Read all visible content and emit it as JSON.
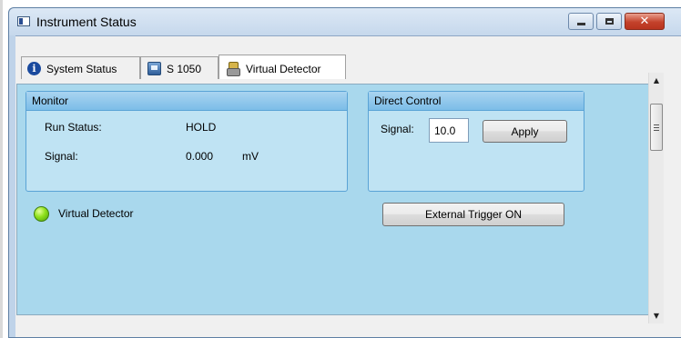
{
  "window": {
    "title": "Instrument Status",
    "buttons": {
      "minimize": "minimize",
      "maximize": "maximize",
      "close": "✕"
    }
  },
  "tabs": [
    {
      "label": "System Status",
      "icon": "info-icon"
    },
    {
      "label": "S 1050",
      "icon": "device-icon"
    },
    {
      "label": "Virtual Detector",
      "icon": "virtual-detector-icon",
      "active": true
    }
  ],
  "monitor": {
    "title": "Monitor",
    "run_status_label": "Run Status:",
    "run_status_value": "HOLD",
    "signal_label": "Signal:",
    "signal_value": "0.000",
    "signal_unit": "mV"
  },
  "direct_control": {
    "title": "Direct Control",
    "signal_label": "Signal:",
    "signal_input_value": "10.0",
    "apply_label": "Apply"
  },
  "detector": {
    "name": "Virtual Detector",
    "status_color": "#8fe11c"
  },
  "external_trigger_label": "External Trigger ON",
  "scrollbar": {
    "up": "▲",
    "down": "▼"
  }
}
